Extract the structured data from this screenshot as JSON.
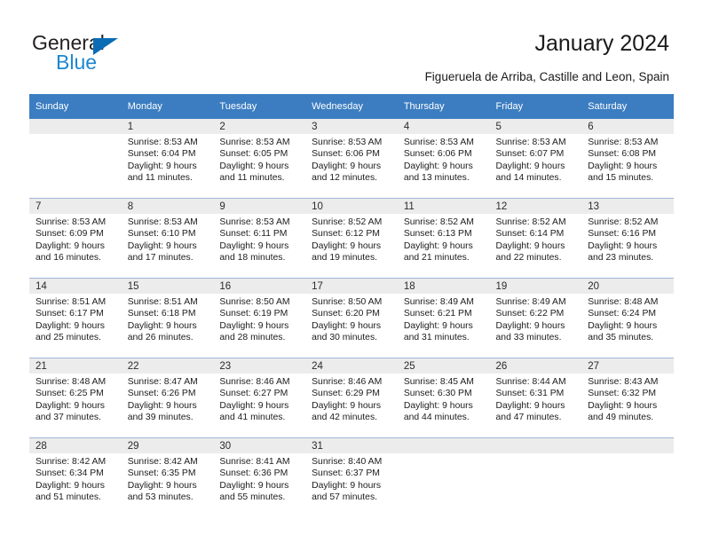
{
  "brand": {
    "name_top": "General",
    "name_bottom": "Blue",
    "triangle_color": "#0a6cb5",
    "blue_text_color": "#1b87d1"
  },
  "header": {
    "title": "January 2024",
    "subtitle": "Figueruela de Arriba, Castille and Leon, Spain"
  },
  "theme": {
    "header_bg": "#3b7dc0",
    "daynum_bg": "#ececec",
    "grid_line": "#9fb8d4"
  },
  "calendar": {
    "weekday_headers": [
      "Sunday",
      "Monday",
      "Tuesday",
      "Wednesday",
      "Thursday",
      "Friday",
      "Saturday"
    ],
    "weeks": [
      [
        {
          "day": "",
          "empty": true,
          "sunrise": "",
          "sunset": "",
          "daylight1": "",
          "daylight2": ""
        },
        {
          "day": "1",
          "sunrise": "Sunrise: 8:53 AM",
          "sunset": "Sunset: 6:04 PM",
          "daylight1": "Daylight: 9 hours",
          "daylight2": "and 11 minutes."
        },
        {
          "day": "2",
          "sunrise": "Sunrise: 8:53 AM",
          "sunset": "Sunset: 6:05 PM",
          "daylight1": "Daylight: 9 hours",
          "daylight2": "and 11 minutes."
        },
        {
          "day": "3",
          "sunrise": "Sunrise: 8:53 AM",
          "sunset": "Sunset: 6:06 PM",
          "daylight1": "Daylight: 9 hours",
          "daylight2": "and 12 minutes."
        },
        {
          "day": "4",
          "sunrise": "Sunrise: 8:53 AM",
          "sunset": "Sunset: 6:06 PM",
          "daylight1": "Daylight: 9 hours",
          "daylight2": "and 13 minutes."
        },
        {
          "day": "5",
          "sunrise": "Sunrise: 8:53 AM",
          "sunset": "Sunset: 6:07 PM",
          "daylight1": "Daylight: 9 hours",
          "daylight2": "and 14 minutes."
        },
        {
          "day": "6",
          "sunrise": "Sunrise: 8:53 AM",
          "sunset": "Sunset: 6:08 PM",
          "daylight1": "Daylight: 9 hours",
          "daylight2": "and 15 minutes."
        }
      ],
      [
        {
          "day": "7",
          "sunrise": "Sunrise: 8:53 AM",
          "sunset": "Sunset: 6:09 PM",
          "daylight1": "Daylight: 9 hours",
          "daylight2": "and 16 minutes."
        },
        {
          "day": "8",
          "sunrise": "Sunrise: 8:53 AM",
          "sunset": "Sunset: 6:10 PM",
          "daylight1": "Daylight: 9 hours",
          "daylight2": "and 17 minutes."
        },
        {
          "day": "9",
          "sunrise": "Sunrise: 8:53 AM",
          "sunset": "Sunset: 6:11 PM",
          "daylight1": "Daylight: 9 hours",
          "daylight2": "and 18 minutes."
        },
        {
          "day": "10",
          "sunrise": "Sunrise: 8:52 AM",
          "sunset": "Sunset: 6:12 PM",
          "daylight1": "Daylight: 9 hours",
          "daylight2": "and 19 minutes."
        },
        {
          "day": "11",
          "sunrise": "Sunrise: 8:52 AM",
          "sunset": "Sunset: 6:13 PM",
          "daylight1": "Daylight: 9 hours",
          "daylight2": "and 21 minutes."
        },
        {
          "day": "12",
          "sunrise": "Sunrise: 8:52 AM",
          "sunset": "Sunset: 6:14 PM",
          "daylight1": "Daylight: 9 hours",
          "daylight2": "and 22 minutes."
        },
        {
          "day": "13",
          "sunrise": "Sunrise: 8:52 AM",
          "sunset": "Sunset: 6:16 PM",
          "daylight1": "Daylight: 9 hours",
          "daylight2": "and 23 minutes."
        }
      ],
      [
        {
          "day": "14",
          "sunrise": "Sunrise: 8:51 AM",
          "sunset": "Sunset: 6:17 PM",
          "daylight1": "Daylight: 9 hours",
          "daylight2": "and 25 minutes."
        },
        {
          "day": "15",
          "sunrise": "Sunrise: 8:51 AM",
          "sunset": "Sunset: 6:18 PM",
          "daylight1": "Daylight: 9 hours",
          "daylight2": "and 26 minutes."
        },
        {
          "day": "16",
          "sunrise": "Sunrise: 8:50 AM",
          "sunset": "Sunset: 6:19 PM",
          "daylight1": "Daylight: 9 hours",
          "daylight2": "and 28 minutes."
        },
        {
          "day": "17",
          "sunrise": "Sunrise: 8:50 AM",
          "sunset": "Sunset: 6:20 PM",
          "daylight1": "Daylight: 9 hours",
          "daylight2": "and 30 minutes."
        },
        {
          "day": "18",
          "sunrise": "Sunrise: 8:49 AM",
          "sunset": "Sunset: 6:21 PM",
          "daylight1": "Daylight: 9 hours",
          "daylight2": "and 31 minutes."
        },
        {
          "day": "19",
          "sunrise": "Sunrise: 8:49 AM",
          "sunset": "Sunset: 6:22 PM",
          "daylight1": "Daylight: 9 hours",
          "daylight2": "and 33 minutes."
        },
        {
          "day": "20",
          "sunrise": "Sunrise: 8:48 AM",
          "sunset": "Sunset: 6:24 PM",
          "daylight1": "Daylight: 9 hours",
          "daylight2": "and 35 minutes."
        }
      ],
      [
        {
          "day": "21",
          "sunrise": "Sunrise: 8:48 AM",
          "sunset": "Sunset: 6:25 PM",
          "daylight1": "Daylight: 9 hours",
          "daylight2": "and 37 minutes."
        },
        {
          "day": "22",
          "sunrise": "Sunrise: 8:47 AM",
          "sunset": "Sunset: 6:26 PM",
          "daylight1": "Daylight: 9 hours",
          "daylight2": "and 39 minutes."
        },
        {
          "day": "23",
          "sunrise": "Sunrise: 8:46 AM",
          "sunset": "Sunset: 6:27 PM",
          "daylight1": "Daylight: 9 hours",
          "daylight2": "and 41 minutes."
        },
        {
          "day": "24",
          "sunrise": "Sunrise: 8:46 AM",
          "sunset": "Sunset: 6:29 PM",
          "daylight1": "Daylight: 9 hours",
          "daylight2": "and 42 minutes."
        },
        {
          "day": "25",
          "sunrise": "Sunrise: 8:45 AM",
          "sunset": "Sunset: 6:30 PM",
          "daylight1": "Daylight: 9 hours",
          "daylight2": "and 44 minutes."
        },
        {
          "day": "26",
          "sunrise": "Sunrise: 8:44 AM",
          "sunset": "Sunset: 6:31 PM",
          "daylight1": "Daylight: 9 hours",
          "daylight2": "and 47 minutes."
        },
        {
          "day": "27",
          "sunrise": "Sunrise: 8:43 AM",
          "sunset": "Sunset: 6:32 PM",
          "daylight1": "Daylight: 9 hours",
          "daylight2": "and 49 minutes."
        }
      ],
      [
        {
          "day": "28",
          "sunrise": "Sunrise: 8:42 AM",
          "sunset": "Sunset: 6:34 PM",
          "daylight1": "Daylight: 9 hours",
          "daylight2": "and 51 minutes."
        },
        {
          "day": "29",
          "sunrise": "Sunrise: 8:42 AM",
          "sunset": "Sunset: 6:35 PM",
          "daylight1": "Daylight: 9 hours",
          "daylight2": "and 53 minutes."
        },
        {
          "day": "30",
          "sunrise": "Sunrise: 8:41 AM",
          "sunset": "Sunset: 6:36 PM",
          "daylight1": "Daylight: 9 hours",
          "daylight2": "and 55 minutes."
        },
        {
          "day": "31",
          "sunrise": "Sunrise: 8:40 AM",
          "sunset": "Sunset: 6:37 PM",
          "daylight1": "Daylight: 9 hours",
          "daylight2": "and 57 minutes."
        },
        {
          "day": "",
          "empty": true,
          "sunrise": "",
          "sunset": "",
          "daylight1": "",
          "daylight2": ""
        },
        {
          "day": "",
          "empty": true,
          "sunrise": "",
          "sunset": "",
          "daylight1": "",
          "daylight2": ""
        },
        {
          "day": "",
          "empty": true,
          "sunrise": "",
          "sunset": "",
          "daylight1": "",
          "daylight2": ""
        }
      ]
    ]
  }
}
